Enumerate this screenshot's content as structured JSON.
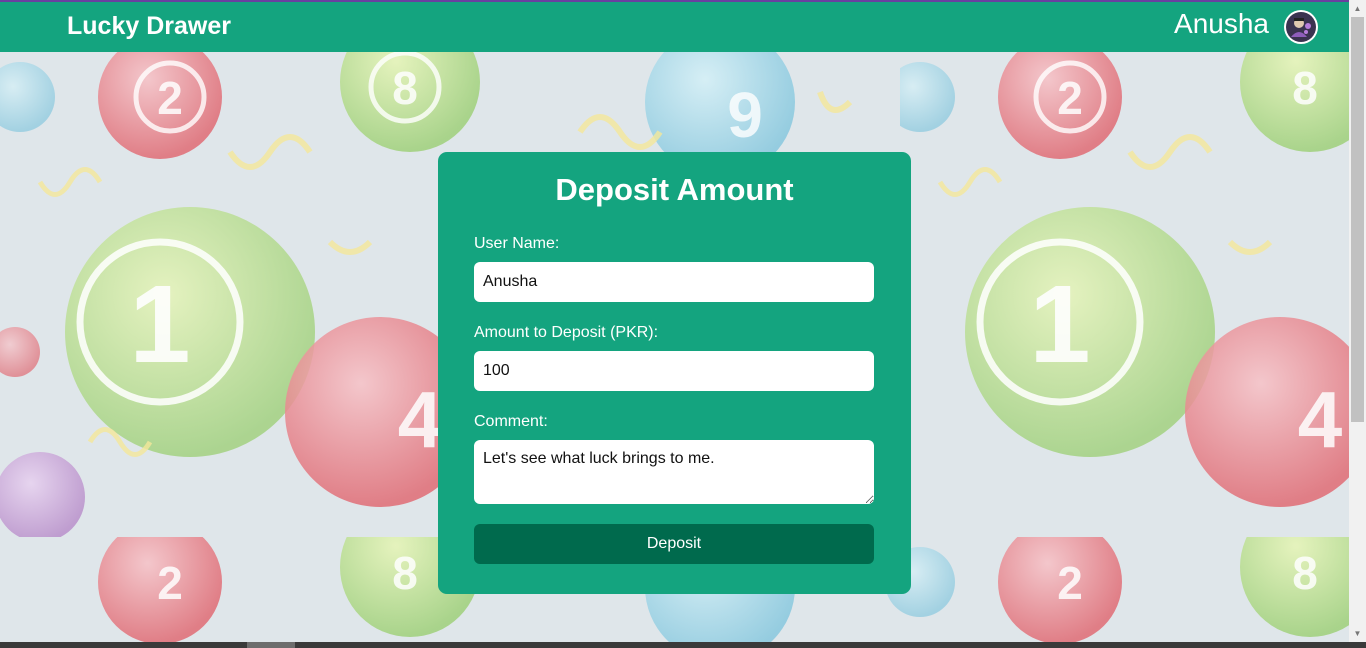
{
  "navbar": {
    "brand": "Lucky Drawer",
    "user_name": "Anusha"
  },
  "form": {
    "title": "Deposit Amount",
    "user_name_label": "User Name:",
    "user_name_value": "Anusha",
    "amount_label": "Amount to Deposit (PKR):",
    "amount_value": "100",
    "comment_label": "Comment:",
    "comment_value": "Let's see what luck brings to me.",
    "submit_label": "Deposit"
  },
  "colors": {
    "primary": "#14a47f",
    "button": "#006a4d",
    "text_on_primary": "#ffffff"
  }
}
